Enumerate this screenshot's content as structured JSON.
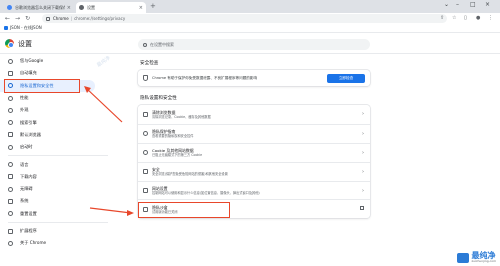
{
  "tabs": [
    {
      "title": "谷歌浏览器怎么关闭下载保存位置询问...",
      "active": false
    },
    {
      "title": "设置",
      "active": true
    }
  ],
  "toolbar": {
    "browser_name": "Chrome",
    "url": "chrome://settings/privacy"
  },
  "bookmarks": [
    "JSON - 在线JSON"
  ],
  "header": {
    "title": "设置",
    "search_placeholder": "在设置中搜索"
  },
  "sidebar": {
    "items": [
      {
        "label": "您与Google",
        "icon": "person-icon"
      },
      {
        "label": "自动填充",
        "icon": "autofill-icon"
      },
      {
        "label": "隐私设置和安全性",
        "icon": "shield-icon",
        "active": true
      },
      {
        "label": "性能",
        "icon": "speedometer-icon"
      },
      {
        "label": "外观",
        "icon": "palette-icon"
      },
      {
        "label": "搜索引擎",
        "icon": "search-icon"
      },
      {
        "label": "默认浏览器",
        "icon": "browser-icon"
      },
      {
        "label": "启动时",
        "icon": "power-icon"
      },
      {
        "label": "语言",
        "icon": "globe-icon"
      },
      {
        "label": "下载内容",
        "icon": "download-icon"
      },
      {
        "label": "无障碍",
        "icon": "accessibility-icon"
      },
      {
        "label": "系统",
        "icon": "wrench-icon"
      },
      {
        "label": "重置设置",
        "icon": "reset-icon"
      },
      {
        "label": "扩展程序",
        "icon": "puzzle-icon"
      },
      {
        "label": "关于 Chrome",
        "icon": "chrome-icon"
      }
    ]
  },
  "safety_check": {
    "section_title": "安全检查",
    "text": "Chrome 有助于保护你免受数据泄露、不良扩展程序等问题的影响",
    "button": "立即检查"
  },
  "privacy": {
    "section_title": "隐私设置和安全性",
    "items": [
      {
        "title": "清除浏览数据",
        "desc": "清除浏览记录、Cookie、缓存及其他数据",
        "icon": "trash-icon",
        "action": "chevron"
      },
      {
        "title": "隐私保护指南",
        "desc": "查看重要的隐私权和安全控件",
        "icon": "guide-icon",
        "action": "chevron"
      },
      {
        "title": "Cookie 及其他网站数据",
        "desc": "已阻止无痕模式下的第三方 Cookie",
        "icon": "cookie-icon",
        "action": "chevron"
      },
      {
        "title": "安全",
        "desc": "安全浏览(保护您免受危险网站的侵害)和其他安全设置",
        "icon": "lock-icon",
        "action": "chevron"
      },
      {
        "title": "网站设置",
        "desc": "控制网站可以使用和显示什么信息(如位置信息、摄像头、弹出式窗口及其他)",
        "icon": "sliders-icon",
        "action": "chevron",
        "highlight": true
      },
      {
        "title": "隐私沙盒",
        "desc": "试用版功能已关闭",
        "icon": "flask-icon",
        "action": "external"
      }
    ]
  },
  "watermark": {
    "brand": "最纯净",
    "site": "zuichunjing.com"
  },
  "colors": {
    "accent": "#1a73e8",
    "highlight": "#e8472b",
    "active_bg": "#e8f0fe"
  }
}
